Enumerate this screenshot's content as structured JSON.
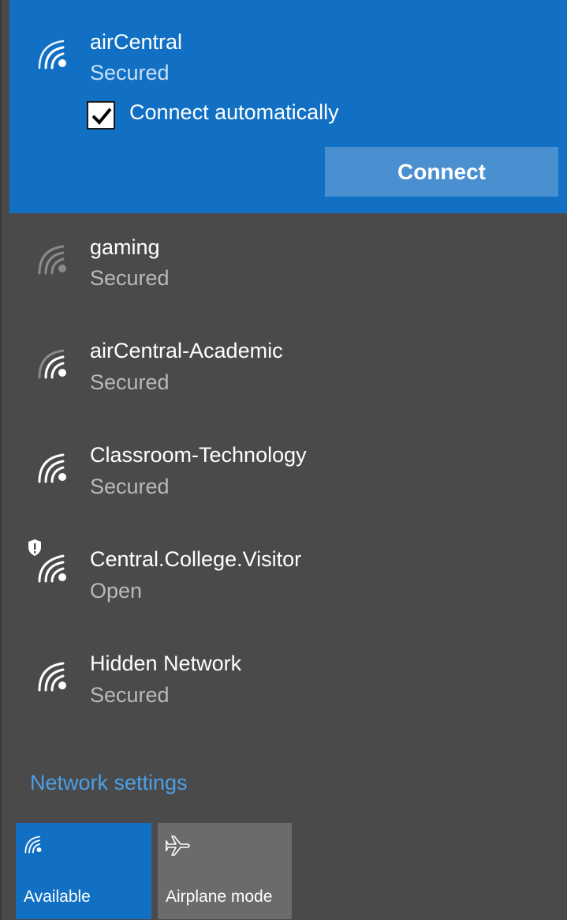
{
  "selected_network": {
    "name": "airCentral",
    "status": "Secured",
    "connect_auto_label": "Connect automatically",
    "connect_auto_checked": true,
    "connect_button_label": "Connect"
  },
  "networks": [
    {
      "name": "gaming",
      "status": "Secured",
      "icon": "wifi-weak-icon"
    },
    {
      "name": "airCentral-Academic",
      "status": "Secured",
      "icon": "wifi-icon"
    },
    {
      "name": "Classroom-Technology",
      "status": "Secured",
      "icon": "wifi-icon"
    },
    {
      "name": "Central.College.Visitor",
      "status": "Open",
      "icon": "wifi-open-shield-icon"
    },
    {
      "name": "Hidden Network",
      "status": "Secured",
      "icon": "wifi-icon"
    }
  ],
  "settings_link": "Network settings",
  "quick_actions": [
    {
      "label": "Available",
      "icon": "wifi-icon",
      "active": true
    },
    {
      "label": "Airplane mode",
      "icon": "airplane-icon",
      "active": false
    }
  ],
  "colors": {
    "accent": "#1170c4",
    "panel": "#4a4a4a",
    "link": "#4aa0e8"
  }
}
